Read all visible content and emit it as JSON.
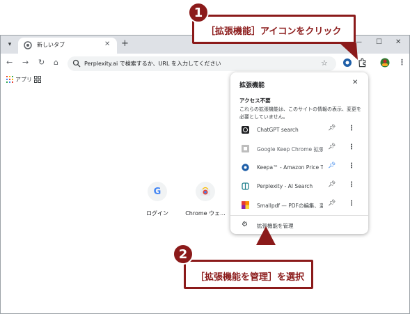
{
  "browser": {
    "tab": {
      "title": "新しいタブ"
    },
    "omnibox": {
      "placeholder": "Perplexity.ai で検索するか、URL を入力してください"
    },
    "bookmarks": {
      "apps_label": "アプリ"
    }
  },
  "shortcuts": [
    {
      "label": "ログイン",
      "letter": "G"
    },
    {
      "label": "Chrome ウェ..."
    }
  ],
  "extensions_popup": {
    "title": "拡張機能",
    "section_title": "アクセス不要",
    "section_desc": "これらの拡張機能は、このサイトの情報の表示、変更を必要としていません。",
    "items": [
      {
        "name": "ChatGPT search",
        "icon": "chatgpt-icon",
        "pinned": true
      },
      {
        "name": "Google Keep Chrome 拡張...",
        "icon": "google-keep-icon",
        "pinned": true
      },
      {
        "name": "Keepa™ - Amazon Price Tr...",
        "icon": "keepa-icon",
        "pinned": false
      },
      {
        "name": "Perplexity - AI Search",
        "icon": "perplexity-icon",
        "pinned": true
      },
      {
        "name": "Smallpdf — PDFの編集、変...",
        "icon": "smallpdf-icon",
        "pinned": true
      }
    ],
    "manage_label": "拡張機能を管理"
  },
  "callouts": [
    {
      "number": "1",
      "text": "［拡張機能］アイコンをクリック"
    },
    {
      "number": "2",
      "text": "［拡張機能を管理］を選択"
    }
  ],
  "colors": {
    "callout": "#8b1a1a"
  }
}
